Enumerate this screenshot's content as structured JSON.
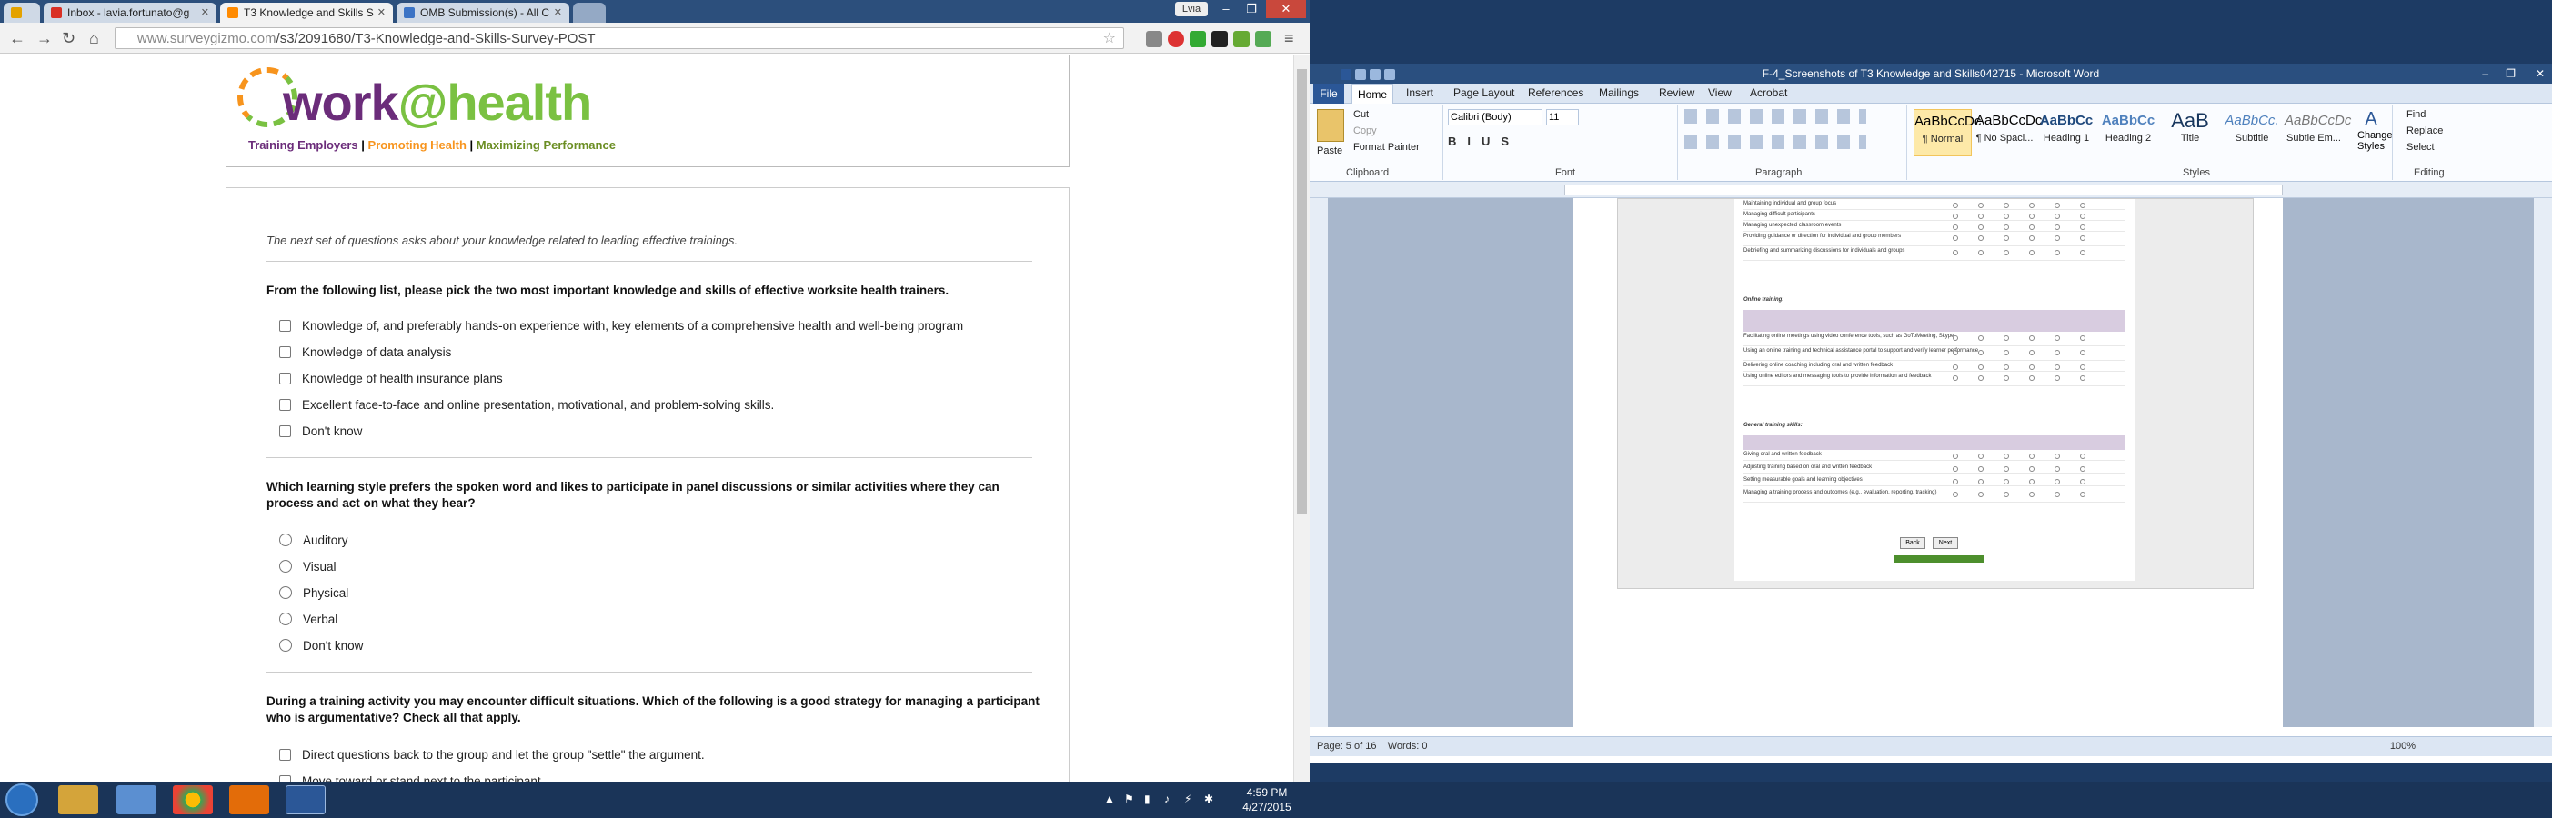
{
  "chrome": {
    "tabs": [
      {
        "label": "Inbox - lavia.fortunato@g",
        "active": false
      },
      {
        "label": "T3 Knowledge and Skills S",
        "active": true
      },
      {
        "label": "OMB Submission(s) - All C",
        "active": false
      }
    ],
    "user_badge": "Lvia",
    "url_scheme": "www.surveygizmo.com",
    "url_path": "/s3/2091680/T3-Knowledge-and-Skills-Survey-POST"
  },
  "brand": {
    "logo_left": "work",
    "logo_at": "@",
    "logo_right": "health",
    "tag1": "Training Employers",
    "tag2": "Promoting Health",
    "tag3": "Maximizing Performance",
    "sep": "|"
  },
  "survey": {
    "intro": "The next set of questions asks about your knowledge related to leading effective trainings.",
    "q1": {
      "text": "From the following list, please pick the two most important knowledge and skills of effective worksite health trainers.",
      "options": [
        "Knowledge of, and preferably hands-on experience with, key elements of a comprehensive health and well-being program",
        "Knowledge of data analysis",
        "Knowledge of health insurance plans",
        "Excellent face-to-face and online presentation, motivational, and problem-solving skills.",
        "Don't know"
      ]
    },
    "q2": {
      "text": "Which learning style prefers the spoken word and likes to participate in panel discussions or similar activities where they can process and act on what they hear?",
      "options": [
        "Auditory",
        "Visual",
        "Physical",
        "Verbal",
        "Don't know"
      ]
    },
    "q3": {
      "text": "During a training activity you may encounter difficult situations.  Which of the following is a good strategy for managing a participant who is argumentative? Check all that apply.",
      "options": [
        "Direct questions back to the group and let the group \"settle\" the argument.",
        "Move toward or stand next to the participant"
      ]
    }
  },
  "word": {
    "title": "F-4_Screenshots of T3 Knowledge and Skills042715 - Microsoft Word",
    "tabs": [
      "File",
      "Home",
      "Insert",
      "Page Layout",
      "References",
      "Mailings",
      "Review",
      "View",
      "Acrobat"
    ],
    "clipboard": {
      "paste": "Paste",
      "cut": "Cut",
      "copy": "Copy",
      "painter": "Format Painter",
      "label": "Clipboard"
    },
    "font": {
      "name": "Calibri (Body)",
      "size": "11",
      "label": "Font"
    },
    "paragraph_label": "Paragraph",
    "styles_label": "Styles",
    "styles": [
      {
        "sample": "AaBbCcDc",
        "name": "¶ Normal"
      },
      {
        "sample": "AaBbCcDc",
        "name": "¶ No Spaci..."
      },
      {
        "sample": "AaBbCc",
        "name": "Heading 1"
      },
      {
        "sample": "AaBbCc",
        "name": "Heading 2"
      },
      {
        "sample": "AaB",
        "name": "Title"
      },
      {
        "sample": "AaBbCc.",
        "name": "Subtitle"
      },
      {
        "sample": "AaBbCcDc",
        "name": "Subtle Em..."
      }
    ],
    "change_styles": "Change Styles",
    "editing": {
      "find": "Find",
      "replace": "Replace",
      "select": "Select",
      "label": "Editing"
    },
    "status_page": "Page: 5 of 16",
    "status_words": "Words: 0",
    "zoom": "100%"
  },
  "embedded": {
    "rows_top": [
      "Maintaining individual and group focus",
      "Managing difficult participants",
      "Managing unexpected classroom events",
      "Providing guidance or direction for individual and group members",
      "Debriefing and summarizing discussions for individuals and groups"
    ],
    "online_label": "Online training:",
    "online_rows": [
      "Facilitating online meetings using video conference tools, such as GoToMeeting, Skype",
      "Using an online training and technical assistance portal to support and verify learner performance",
      "Delivering online coaching including oral and written feedback",
      "Using online editors and messaging tools to provide information and feedback"
    ],
    "general_label": "General training skills:",
    "general_rows": [
      "Giving oral and written feedback",
      "Adjusting training based on oral and written feedback",
      "Setting measurable goals and learning objectives",
      "Managing a training process and outcomes (e.g., evaluation, reporting, tracking)"
    ],
    "back": "Back",
    "next": "Next"
  },
  "taskbar": {
    "time": "4:59 PM",
    "date": "4/27/2015"
  }
}
